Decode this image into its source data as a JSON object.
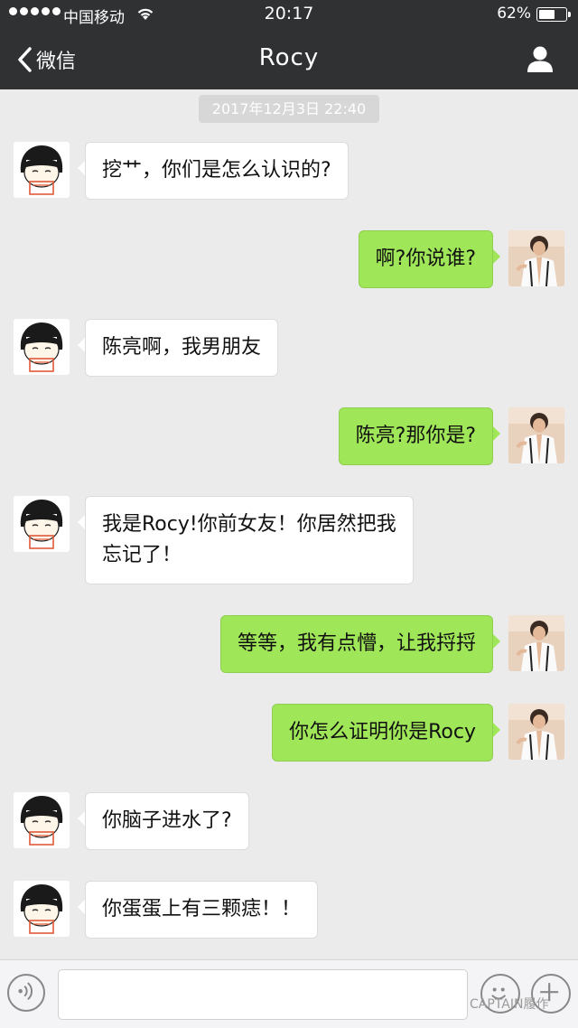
{
  "status_bar": {
    "carrier": "中国移动",
    "time": "20:17",
    "battery": "62%",
    "battery_level": 0.62
  },
  "nav": {
    "back_label": "微信",
    "title": "Rocy"
  },
  "timestamp": "2017年12月3日 22:40",
  "messages": [
    {
      "side": "left",
      "text": "挖艹，你们是怎么认识的?"
    },
    {
      "side": "right",
      "text": "啊?你说谁?"
    },
    {
      "side": "left",
      "text": "陈亮啊，我男朋友"
    },
    {
      "side": "right",
      "text": "陈亮?那你是?"
    },
    {
      "side": "left",
      "text": "我是Rocy!你前女友！你居然把我\n忘记了！"
    },
    {
      "side": "right",
      "text": "等等，我有点懵，让我捋捋"
    },
    {
      "side": "right",
      "text": "你怎么证明你是Rocy"
    },
    {
      "side": "left",
      "text": "你脑子进水了?"
    },
    {
      "side": "left",
      "text": "你蛋蛋上有三颗痣！！"
    }
  ],
  "input_bar": {
    "watermark": "CAPTAIN履作"
  },
  "colors": {
    "bar": "#2f3133",
    "bubble_right": "#9fe658",
    "bubble_left": "#ffffff",
    "chat_bg": "#ebebeb"
  }
}
